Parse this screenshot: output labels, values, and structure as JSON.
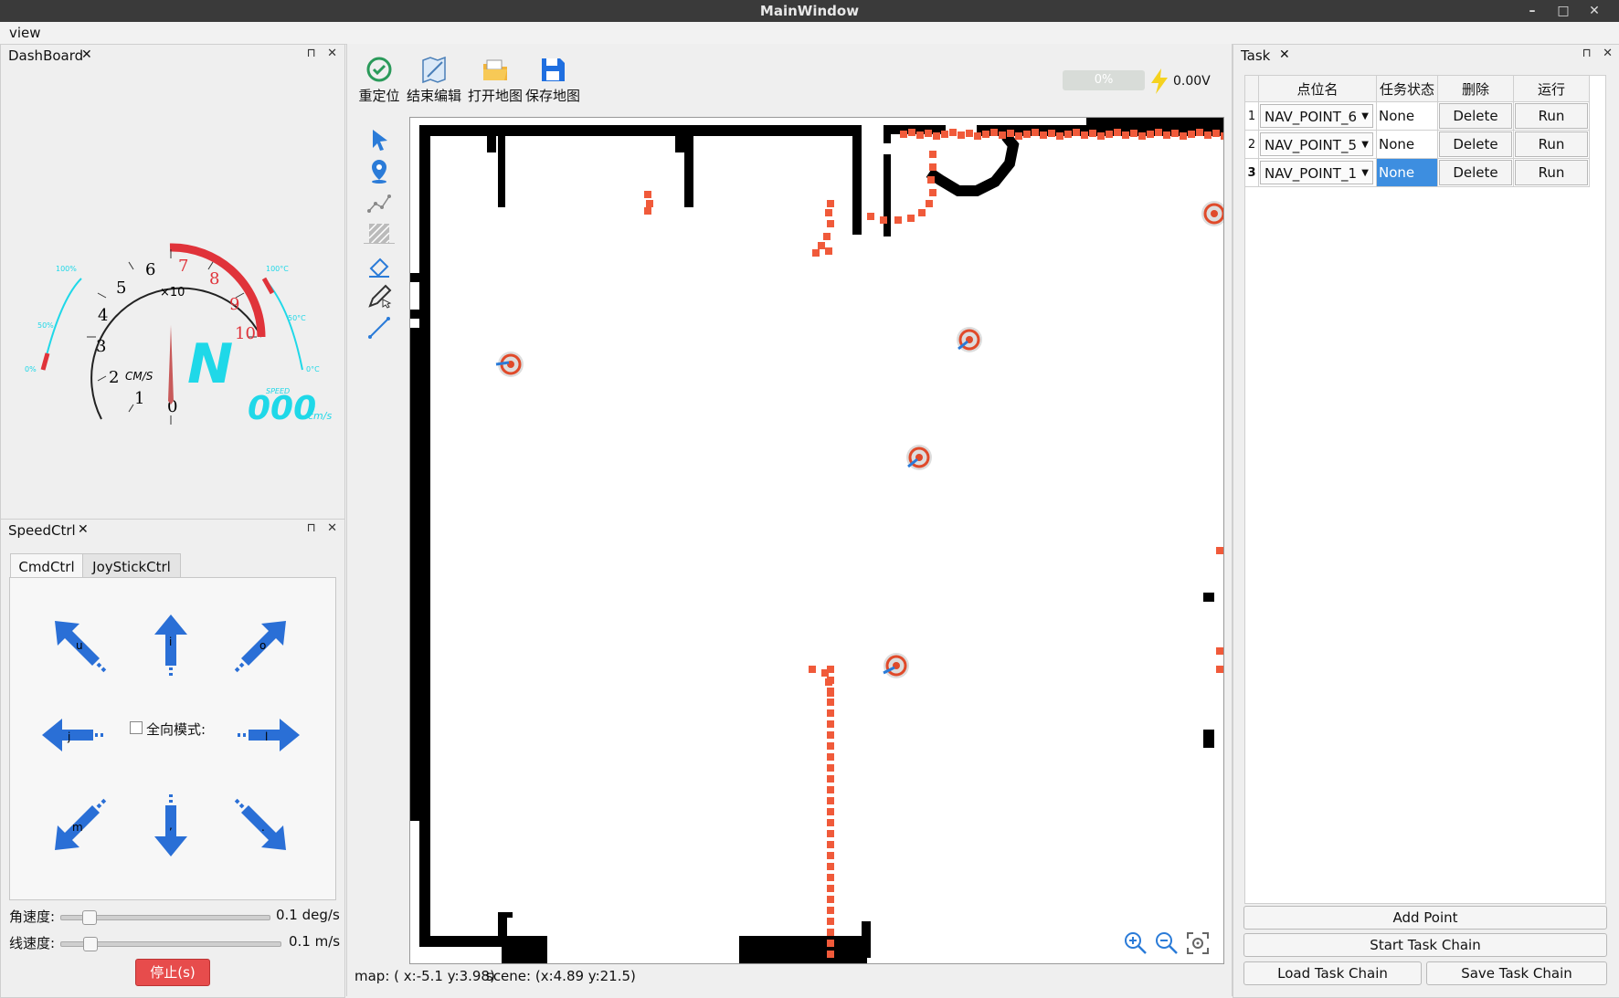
{
  "window": {
    "title": "MainWindow",
    "min_glyph": "–",
    "max_glyph": "□",
    "close_glyph": "✕"
  },
  "menu": {
    "view": "view"
  },
  "dashboard": {
    "title": "DashBoard",
    "unit": "CM/S",
    "multiplier": "×10",
    "ticks": [
      "0",
      "1",
      "2",
      "3",
      "4",
      "5",
      "6",
      "7",
      "8",
      "9",
      "10"
    ],
    "heading": "N",
    "speed_label": "SPEED",
    "speed_value": "000",
    "speed_unit": "cm/s",
    "left_gauge": [
      "100%",
      "50%",
      "0%"
    ],
    "right_gauge": [
      "100°C",
      "50°C",
      "0°C"
    ]
  },
  "toolbar": {
    "relocate": "重定位",
    "end_edit": "结束编辑",
    "open_map": "打开地图",
    "save_map": "保存地图",
    "battery_percent": "0%",
    "voltage": "0.00V"
  },
  "status": {
    "map": "map: ( x:-5.1 y:3.98)",
    "scene": "scene: (x:4.89 y:21.5)"
  },
  "speedctrl": {
    "title": "SpeedCtrl",
    "tabs": [
      "CmdCtrl",
      "JoyStickCtrl"
    ],
    "keys": {
      "u": "u",
      "i": "i",
      "o": "o",
      "j": "j",
      "l": "l",
      "m": "m",
      "comma": ",",
      "dot": "."
    },
    "omni_label": "全向模式:",
    "angular_label": "角速度:",
    "angular_value": "0.1 deg/s",
    "angular_level": 0.1,
    "linear_label": "线速度:",
    "linear_value": "0.1 m/s",
    "linear_level": 0.1,
    "stop_button": "停止(s)"
  },
  "task": {
    "title": "Task",
    "headers": [
      "点位名",
      "任务状态",
      "删除",
      "运行"
    ],
    "rows": [
      {
        "index": "1",
        "point": "NAV_POINT_6",
        "status": "None",
        "delete": "Delete",
        "run": "Run"
      },
      {
        "index": "2",
        "point": "NAV_POINT_5",
        "status": "None",
        "delete": "Delete",
        "run": "Run"
      },
      {
        "index": "3",
        "point": "NAV_POINT_1",
        "status": "None",
        "delete": "Delete",
        "run": "Run"
      }
    ],
    "add_point": "Add Point",
    "start_chain": "Start Task Chain",
    "load_chain": "Load Task Chain",
    "save_chain": "Save Task Chain"
  },
  "colors": {
    "accent": "#2a6fd6",
    "selected": "#3d8ee0",
    "stop": "#e74c4c",
    "laser": "#f05a3a",
    "gauge_cyan": "#1fd8e8"
  }
}
